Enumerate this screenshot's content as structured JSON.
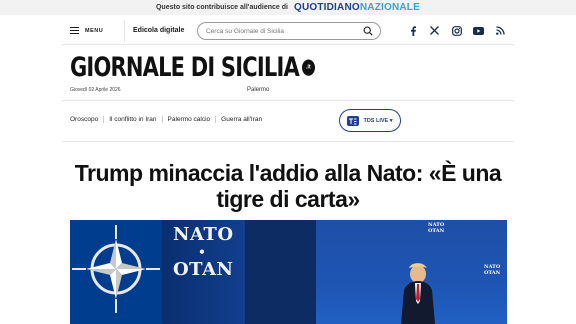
{
  "banner": {
    "promo_text": "Questo sito contribuisce all'audience di",
    "network_part1": "QUOTIDIANO",
    "network_part2": "NAZIONALE"
  },
  "header": {
    "menu_label": "MENU",
    "edicola_label": "Edicola digitale",
    "search_placeholder": "Cerca su Giornale di Sicilia",
    "social_icons": [
      "facebook-icon",
      "x-icon",
      "instagram-icon",
      "youtube-icon",
      "rss-icon"
    ]
  },
  "masthead": {
    "brand": "GIORNALE DI SICILIA",
    "brand_suffix": ".it",
    "date": "Giovedì 02 Aprile 2026",
    "city": "Palermo"
  },
  "section_nav": {
    "links": [
      "Oroscopo",
      "Il conflitto in Iran",
      "Palermo calcio",
      "Guerra all'Iran"
    ],
    "live_label": "TDS LIVE ▾"
  },
  "article": {
    "headline": "Trump minaccia l'addio alla Nato: «È una tigre di carta»"
  },
  "hero_image": {
    "sign_line1": "NATO",
    "sign_dot": "•",
    "sign_line2": "OTAN",
    "mini_sign_a1": "NATO",
    "mini_sign_a2": "OTAN",
    "mini_sign_b1": "NATO",
    "mini_sign_b2": "OTAN"
  },
  "colors": {
    "brand_blue": "#1f3f8f",
    "brand_light_blue": "#3aa0dc",
    "text_dark": "#111111"
  }
}
